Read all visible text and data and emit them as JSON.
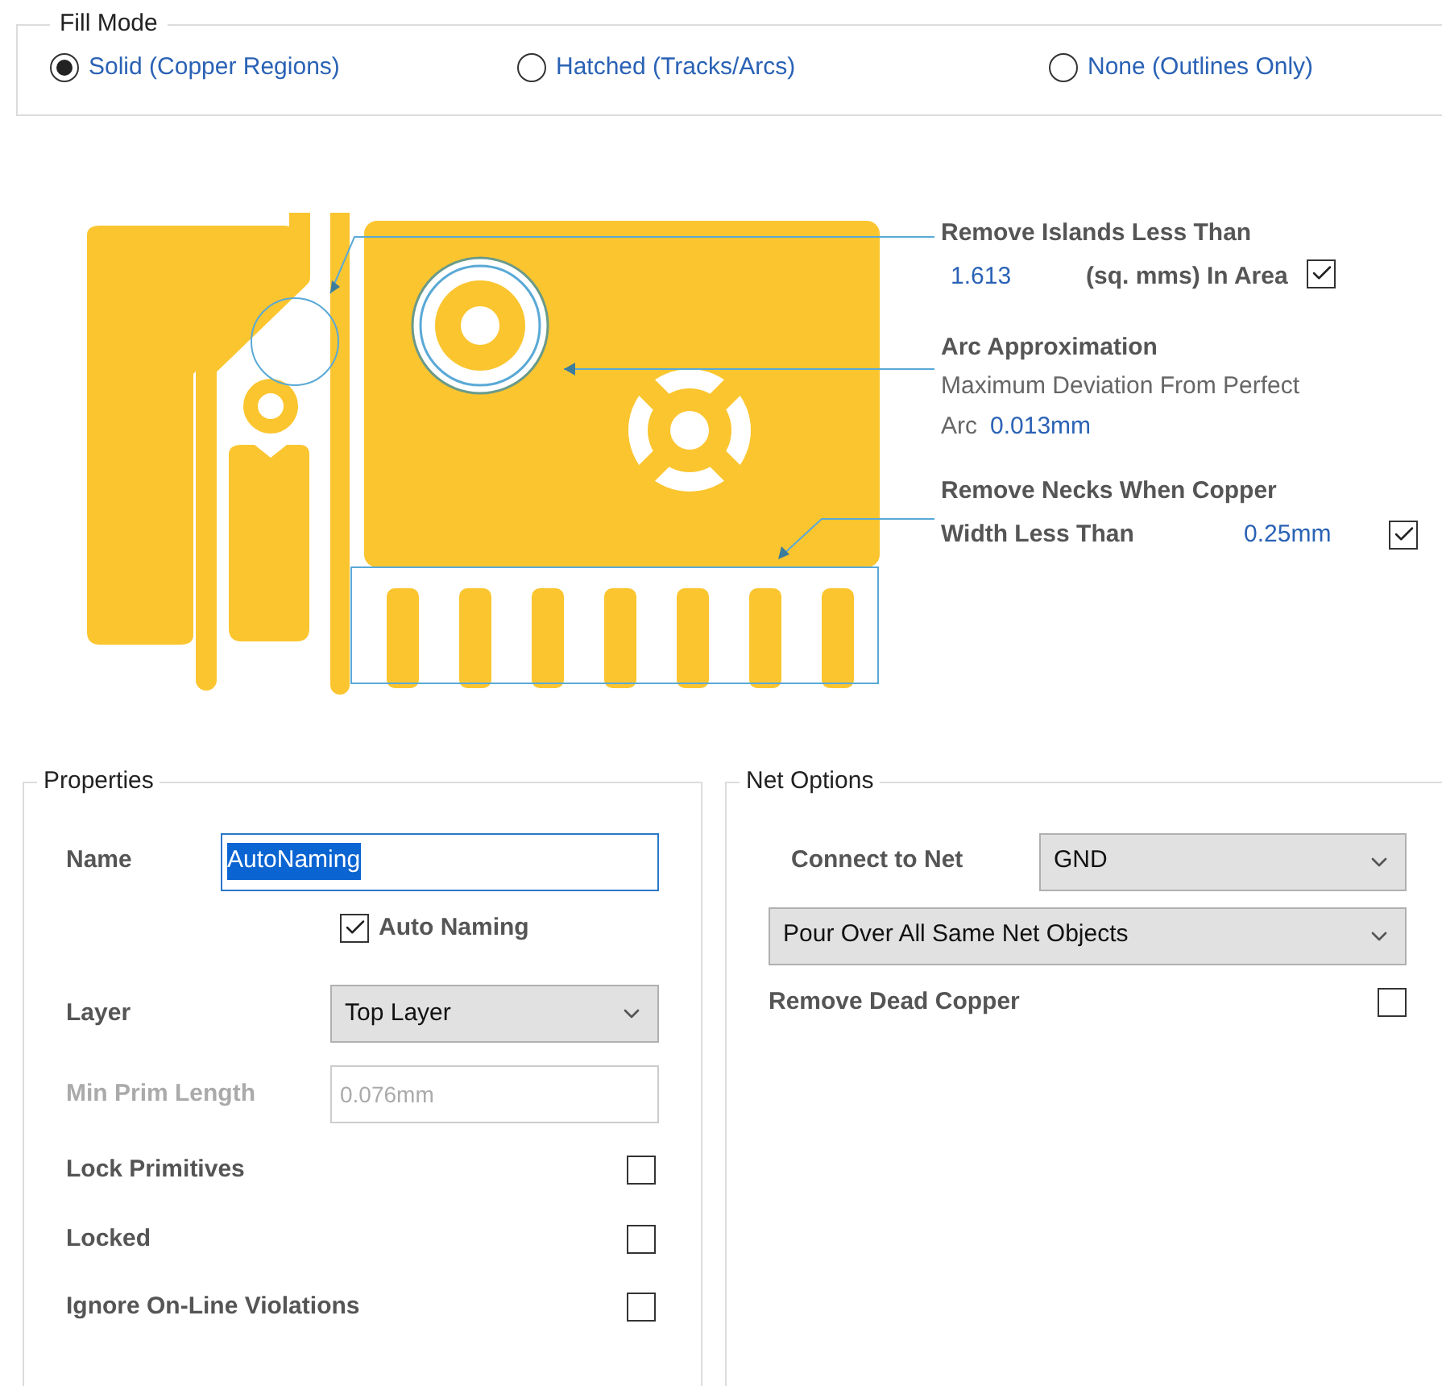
{
  "fill_mode": {
    "title": "Fill Mode",
    "options": [
      {
        "label": "Solid (Copper Regions)",
        "selected": true
      },
      {
        "label": "Hatched (Tracks/Arcs)",
        "selected": false
      },
      {
        "label": "None (Outlines Only)",
        "selected": false
      }
    ]
  },
  "diagram_options": [
    {
      "kind": "islands",
      "title": "Remove Islands Less Than",
      "value": "1.613",
      "label": "(sq. mms) In Area",
      "checked": true
    },
    {
      "kind": "arc",
      "title": "Arc Approximation",
      "label": "Maximum Deviation From Perfect",
      "label2": "Arc",
      "value": "0.013mm"
    },
    {
      "kind": "necks",
      "title": "Remove Necks When Copper",
      "label": "Width Less Than",
      "value": "0.25mm",
      "checked": true
    }
  ],
  "properties": {
    "title": "Properties",
    "name": {
      "label": "Name",
      "value": "AutoNaming"
    },
    "auto_naming": {
      "label": "Auto Naming",
      "checked": true
    },
    "layer": {
      "label": "Layer",
      "value": "Top Layer"
    },
    "min_prim_length": {
      "label": "Min Prim Length",
      "value": "0.076mm",
      "disabled": true
    },
    "checks": [
      {
        "label": "Lock Primitives",
        "checked": false
      },
      {
        "label": "Locked",
        "checked": false
      },
      {
        "label": "Ignore On-Line Violations",
        "checked": false
      }
    ]
  },
  "net_options": {
    "title": "Net Options",
    "connect": {
      "label": "Connect to Net",
      "value": "GND"
    },
    "pour": {
      "value": "Pour Over All Same Net Objects"
    },
    "dead_copper": {
      "label": "Remove Dead Copper",
      "checked": false
    }
  }
}
